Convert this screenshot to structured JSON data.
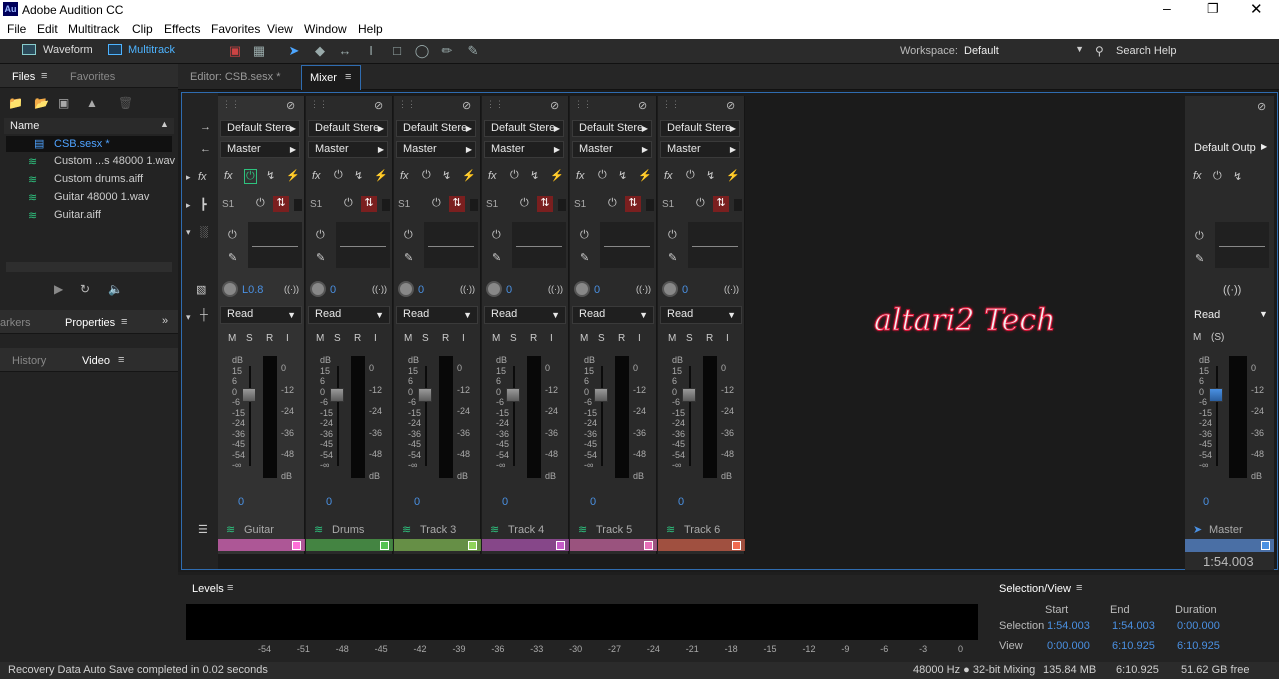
{
  "app": {
    "title": "Adobe Audition CC",
    "logo": "Au"
  },
  "window_controls": [
    "minimize-icon",
    "restore-icon",
    "close-icon"
  ],
  "menu": [
    "File",
    "Edit",
    "Multitrack",
    "Clip",
    "Effects",
    "Favorites",
    "View",
    "Window",
    "Help"
  ],
  "toolbar": {
    "waveform_label": "Waveform",
    "multitrack_label": "Multitrack",
    "workspace_label": "Workspace:",
    "workspace_value": "Default",
    "search_label": "Search Help"
  },
  "files_panel": {
    "tab_files": "Files",
    "tab_favorites": "Favorites",
    "column_name": "Name",
    "items": [
      "CSB.sesx *",
      "Custom ...s 48000 1.wav",
      "Custom drums.aiff",
      "Guitar 48000 1.wav",
      "Guitar.aiff"
    ]
  },
  "left_tabs": {
    "markers": "arkers",
    "properties": "Properties",
    "history": "History",
    "video": "Video"
  },
  "editor_tabs": {
    "editor": "Editor: CSB.sesx *",
    "mixer": "Mixer"
  },
  "mixer": {
    "tracks": [
      {
        "name": "Guitar",
        "input": "Default Stere",
        "output": "Master",
        "send": "S1",
        "pan": "L0.8",
        "mode": "Read",
        "value": "0",
        "color": "#ff6fd8"
      },
      {
        "name": "Drums",
        "input": "Default Stere",
        "output": "Master",
        "send": "S1",
        "pan": "0",
        "mode": "Read",
        "value": "0",
        "color": "#56c253"
      },
      {
        "name": "Track 3",
        "input": "Default Stere",
        "output": "Master",
        "send": "S1",
        "pan": "0",
        "mode": "Read",
        "value": "0",
        "color": "#8fd35a"
      },
      {
        "name": "Track 4",
        "input": "Default Stere",
        "output": "Master",
        "send": "S1",
        "pan": "0",
        "mode": "Read",
        "value": "0",
        "color": "#c55cc9"
      },
      {
        "name": "Track 5",
        "input": "Default Stere",
        "output": "Master",
        "send": "S1",
        "pan": "0",
        "mode": "Read",
        "value": "0",
        "color": "#e66fb8"
      },
      {
        "name": "Track 6",
        "input": "Default Stere",
        "output": "Master",
        "send": "S1",
        "pan": "0",
        "mode": "Read",
        "value": "0",
        "color": "#f06a50"
      }
    ],
    "msri": [
      "M",
      "S",
      "R",
      "I"
    ],
    "fader_scale": [
      "dB",
      "15",
      "6",
      "0",
      "-6",
      "-15",
      "-24",
      "-36",
      "-45",
      "-54",
      "-∞"
    ],
    "meter_scale": [
      "0",
      "-12",
      "-24",
      "-36",
      "-48",
      "dB"
    ],
    "master": {
      "name": "Master",
      "output": "Default Outp",
      "mode": "Read",
      "value": "0",
      "time": "1:54.003",
      "msri": [
        "M",
        "(S)"
      ],
      "meter_scale": [
        "0",
        "-12",
        "-24",
        "-36",
        "-48",
        "dB"
      ]
    }
  },
  "watermark": "altari2 Tech",
  "levels": {
    "title": "Levels",
    "scale": [
      "-54",
      "-51",
      "-48",
      "-45",
      "-42",
      "-39",
      "-36",
      "-33",
      "-30",
      "-27",
      "-24",
      "-21",
      "-18",
      "-15",
      "-12",
      "-9",
      "-6",
      "-3",
      "0"
    ]
  },
  "selection_view": {
    "title": "Selection/View",
    "col_start": "Start",
    "col_end": "End",
    "col_duration": "Duration",
    "row_selection": "Selection",
    "row_view": "View",
    "selection": {
      "start": "1:54.003",
      "end": "1:54.003",
      "duration": "0:00.000"
    },
    "view": {
      "start": "0:00.000",
      "end": "6:10.925",
      "duration": "6:10.925"
    }
  },
  "status": {
    "message": "Recovery Data Auto Save completed in 0.02 seconds",
    "sample": "48000 Hz ● 32-bit Mixing",
    "memory": "135.84 MB",
    "duration": "6:10.925",
    "free": "51.62 GB free"
  },
  "colors": {
    "accent": "#4a90e2",
    "files_highlight": "#2d8cd6",
    "waveform_icon": "#2ec27e"
  }
}
